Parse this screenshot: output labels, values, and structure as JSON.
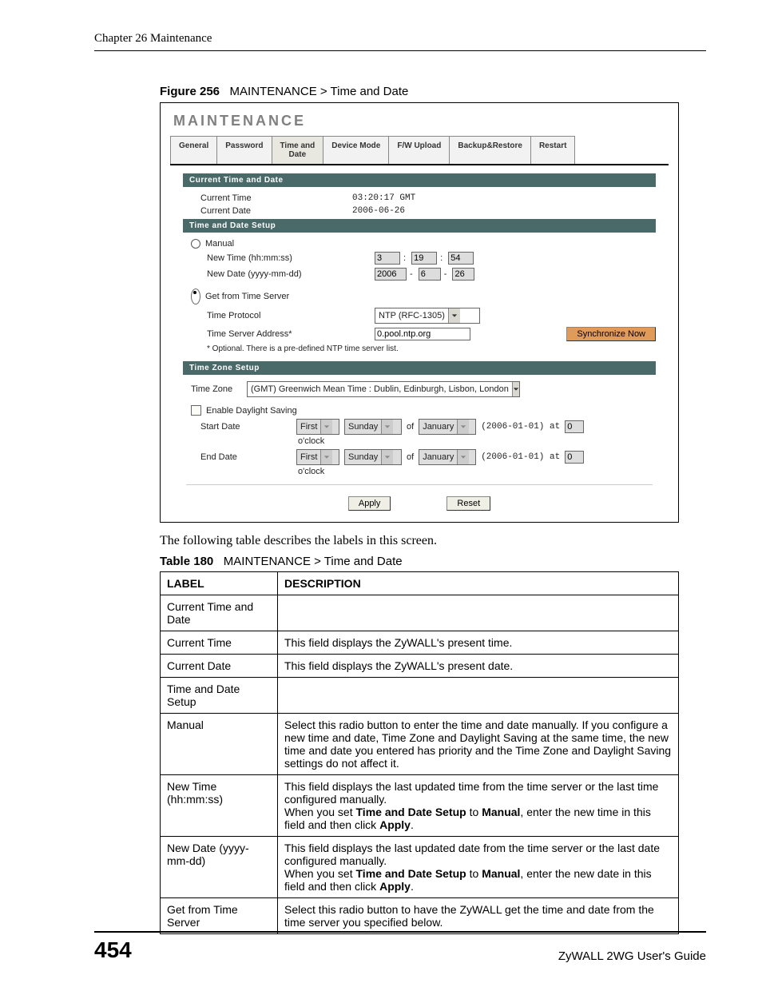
{
  "header": {
    "chapter": "Chapter 26 Maintenance"
  },
  "figure": {
    "num": "Figure 256",
    "title": "MAINTENANCE > Time and Date",
    "app_title": "MAINTENANCE",
    "tabs": [
      "General",
      "Password",
      "Time and Date",
      "Device Mode",
      "F/W Upload",
      "Backup&Restore",
      "Restart"
    ],
    "sections": {
      "current": {
        "heading": "Current Time and Date",
        "time_label": "Current Time",
        "time_value": "03:20:17 GMT",
        "date_label": "Current Date",
        "date_value": "2006-06-26"
      },
      "setup": {
        "heading": "Time and Date Setup",
        "manual_label": "Manual",
        "new_time_label": "New Time (hh:mm:ss)",
        "new_time": {
          "h": "3",
          "m": "19",
          "s": "54"
        },
        "new_date_label": "New Date (yyyy-mm-dd)",
        "new_date": {
          "y": "2006",
          "mo": "6",
          "d": "26"
        },
        "server_label": "Get from Time Server",
        "proto_label": "Time Protocol",
        "proto_value": "NTP (RFC-1305)",
        "addr_label": "Time Server Address*",
        "addr_value": "0.pool.ntp.org",
        "note": "* Optional. There is a pre-defined NTP time server list.",
        "sync_btn": "Synchronize Now"
      },
      "zone": {
        "heading": "Time Zone Setup",
        "tz_label": "Time Zone",
        "tz_value": "(GMT) Greenwich Mean Time : Dublin, Edinburgh, Lisbon, London",
        "dls_label": "Enable Daylight Saving",
        "start_label": "Start Date",
        "end_label": "End Date",
        "ordinal": "First",
        "day": "Sunday",
        "of": "of",
        "month": "January",
        "hint": "(2006-01-01)  at",
        "hour": "0",
        "oclock": "o'clock"
      },
      "buttons": {
        "apply": "Apply",
        "reset": "Reset"
      }
    }
  },
  "body_text": "The following table describes the labels in this screen.",
  "table": {
    "num": "Table 180",
    "title": "MAINTENANCE > Time and Date",
    "head": {
      "label": "LABEL",
      "desc": "DESCRIPTION"
    },
    "rows": [
      {
        "label": "Current Time and Date",
        "desc": ""
      },
      {
        "label": "Current Time",
        "desc": "This field displays the ZyWALL's present time."
      },
      {
        "label": "Current Date",
        "desc": "This field displays the ZyWALL's present date."
      },
      {
        "label": "Time and Date Setup",
        "desc": ""
      },
      {
        "label": "Manual",
        "desc": "Select this radio button to enter the time and date manually. If you configure a new time and date, Time Zone and Daylight Saving at the same time, the new time and date you entered has priority and the Time Zone and Daylight Saving settings do not affect it."
      },
      {
        "label": "New Time (hh:mm:ss)",
        "desc_pre": "This field displays the last updated time from the time server or the last time configured manually.\nWhen you set ",
        "desc_b1": "Time and Date Setup",
        "desc_mid": " to ",
        "desc_b2": "Manual",
        "desc_post": ", enter the new time in this field and then click ",
        "desc_b3": "Apply",
        "desc_end": "."
      },
      {
        "label": "New Date (yyyy-mm-dd)",
        "desc_pre": "This field displays the last updated date from the time server or the last date configured manually.\nWhen you set ",
        "desc_b1": "Time and Date Setup",
        "desc_mid": " to ",
        "desc_b2": "Manual",
        "desc_post": ", enter the new date in this field and then click ",
        "desc_b3": "Apply",
        "desc_end": "."
      },
      {
        "label": "Get from Time Server",
        "desc": "Select this radio button to have the ZyWALL get the time and date from the time server you specified below."
      }
    ]
  },
  "footer": {
    "page": "454",
    "guide": "ZyWALL 2WG User's Guide"
  }
}
